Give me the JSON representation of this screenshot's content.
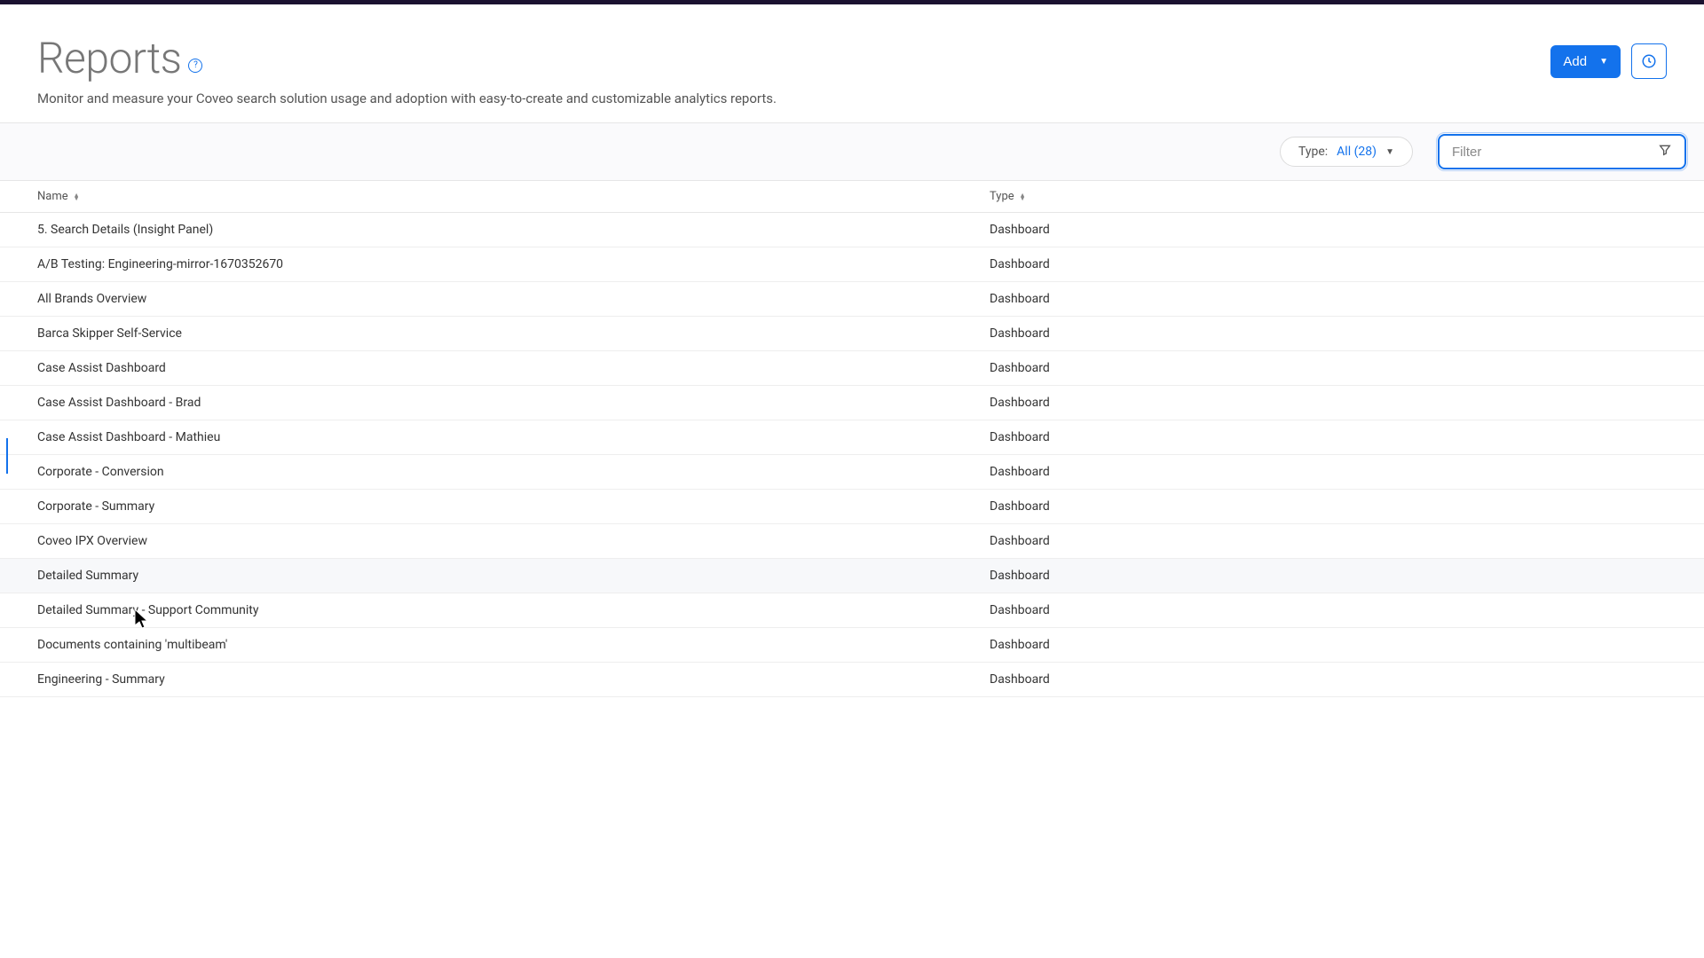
{
  "header": {
    "title": "Reports",
    "subtitle": "Monitor and measure your Coveo search solution usage and adoption with easy-to-create and customizable analytics reports.",
    "add_label": "Add"
  },
  "filters": {
    "type_label": "Type:",
    "type_value": "All (28)",
    "filter_placeholder": "Filter"
  },
  "columns": {
    "name": "Name",
    "type": "Type"
  },
  "rows": [
    {
      "name": "5. Search Details (Insight Panel)",
      "type": "Dashboard"
    },
    {
      "name": "A/B Testing: Engineering-mirror-1670352670",
      "type": "Dashboard"
    },
    {
      "name": "All Brands Overview",
      "type": "Dashboard"
    },
    {
      "name": "Barca Skipper Self-Service",
      "type": "Dashboard"
    },
    {
      "name": "Case Assist Dashboard",
      "type": "Dashboard"
    },
    {
      "name": "Case Assist Dashboard - Brad",
      "type": "Dashboard"
    },
    {
      "name": "Case Assist Dashboard - Mathieu",
      "type": "Dashboard"
    },
    {
      "name": "Corporate - Conversion",
      "type": "Dashboard"
    },
    {
      "name": "Corporate - Summary",
      "type": "Dashboard"
    },
    {
      "name": "Coveo IPX Overview",
      "type": "Dashboard"
    },
    {
      "name": "Detailed Summary",
      "type": "Dashboard",
      "hovered": true
    },
    {
      "name": "Detailed Summary - Support Community",
      "type": "Dashboard"
    },
    {
      "name": "Documents containing 'multibeam'",
      "type": "Dashboard"
    },
    {
      "name": "Engineering - Summary",
      "type": "Dashboard"
    }
  ]
}
